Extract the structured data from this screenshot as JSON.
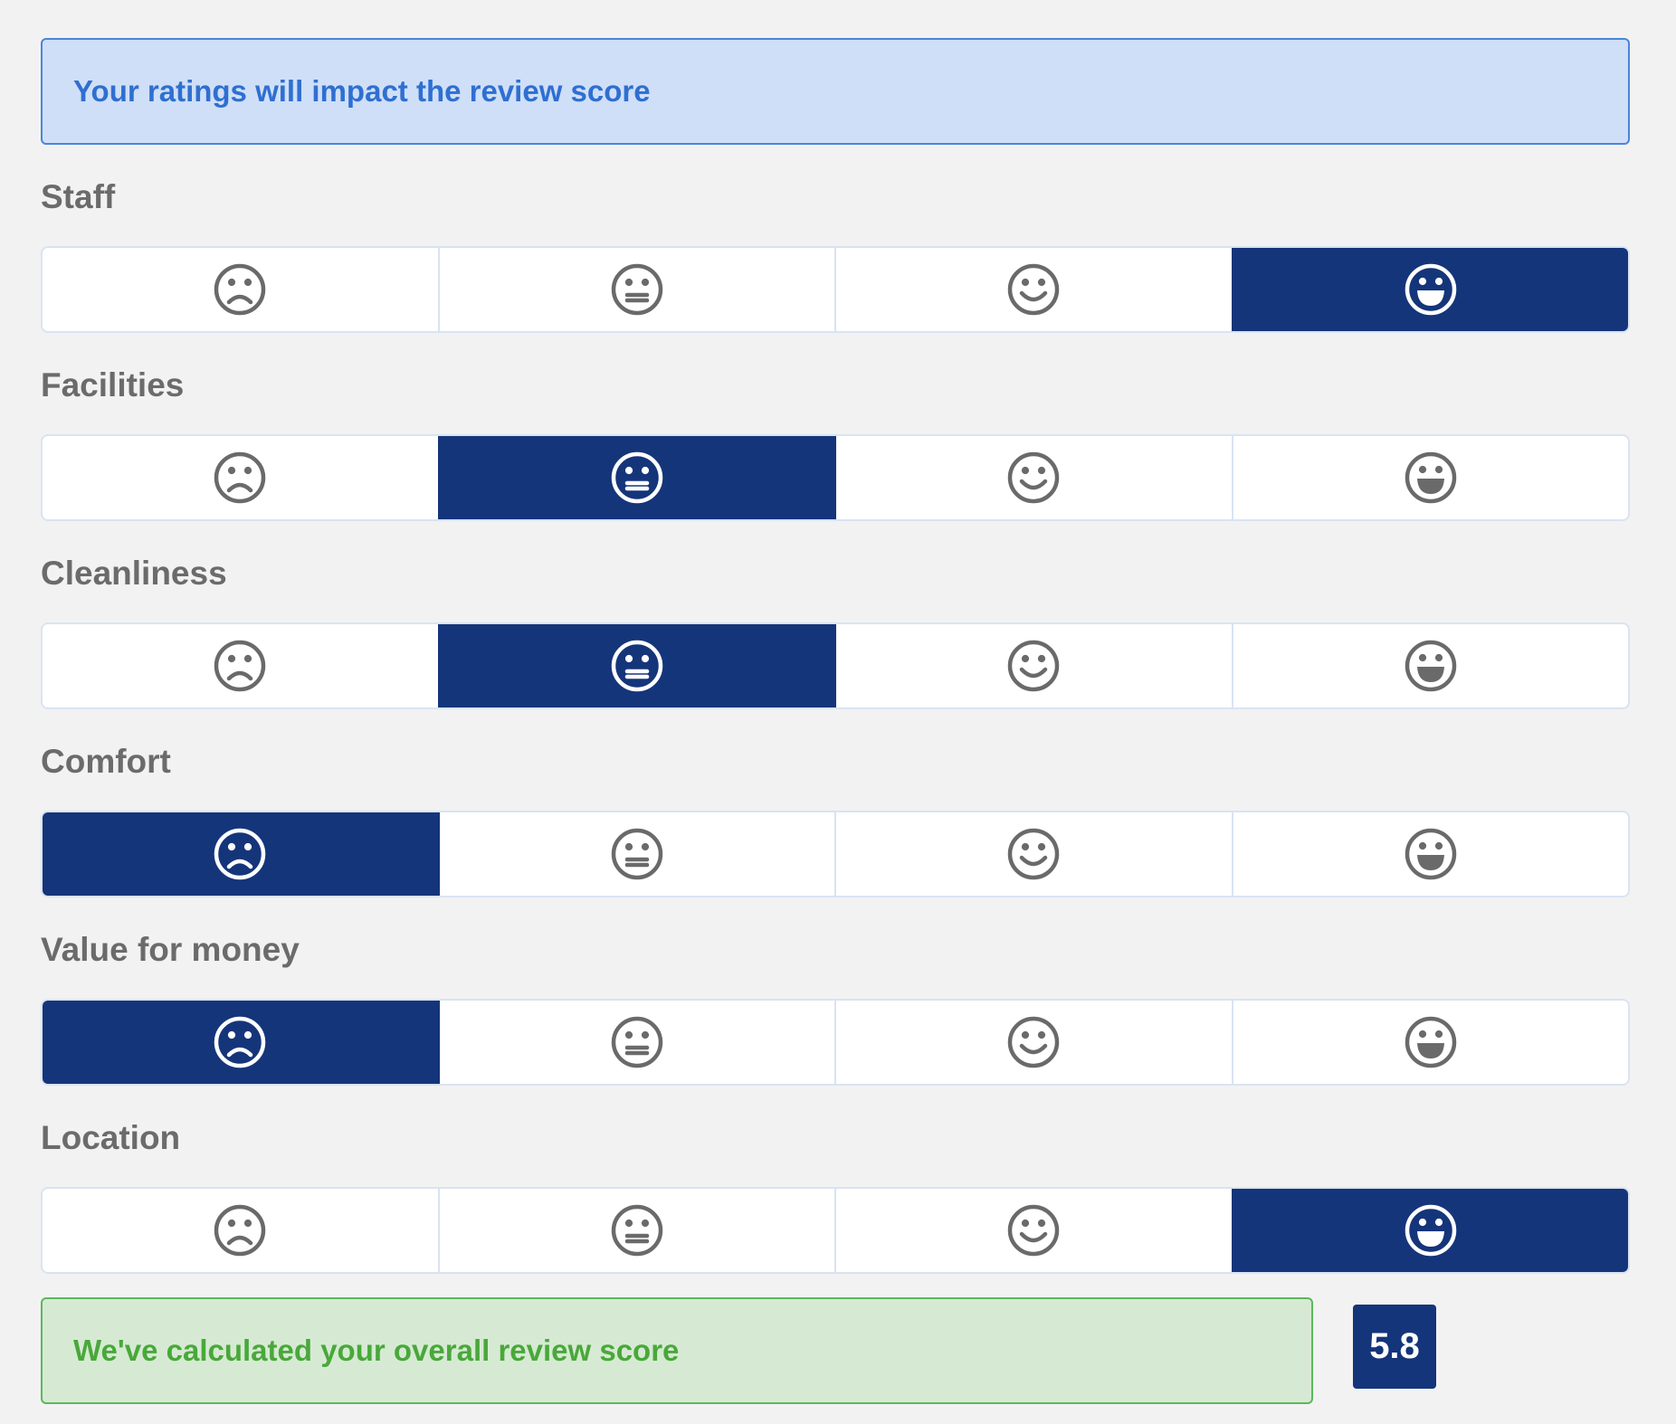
{
  "banner": {
    "text": "Your ratings will impact the review score",
    "color": "#2f6fd0",
    "background": "#cfdff8"
  },
  "face_icons": [
    "sad-face-icon",
    "neutral-face-icon",
    "smile-face-icon",
    "grin-face-icon"
  ],
  "ratings": [
    {
      "label": "Staff",
      "selected_index": 3
    },
    {
      "label": "Facilities",
      "selected_index": 1
    },
    {
      "label": "Cleanliness",
      "selected_index": 1
    },
    {
      "label": "Comfort",
      "selected_index": 0
    },
    {
      "label": "Value for money",
      "selected_index": 0
    },
    {
      "label": "Location",
      "selected_index": 3
    }
  ],
  "selected_color": "#15357a",
  "result": {
    "text": "We've calculated your overall review score",
    "score": "5.8",
    "color": "#49a83a",
    "background": "#d6ead3"
  }
}
